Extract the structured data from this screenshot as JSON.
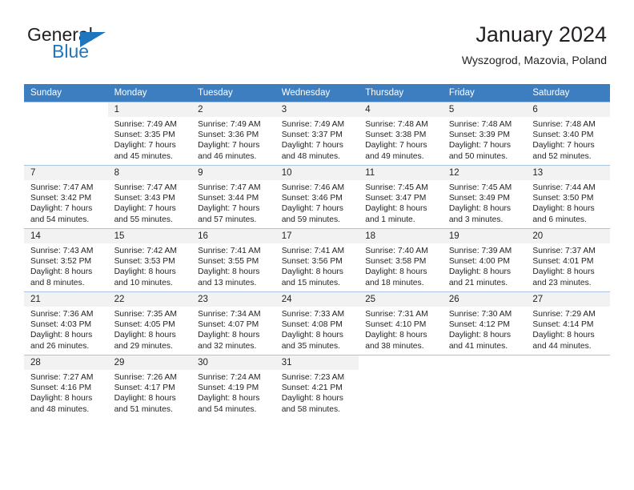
{
  "brand": {
    "name_top": "General",
    "name_bottom": "Blue",
    "color_blue": "#1f76bc",
    "color_dark": "#231f20"
  },
  "header": {
    "title": "January 2024",
    "subtitle": "Wyszogrod, Mazovia, Poland"
  },
  "calendar": {
    "header_background": "#3c7ec0",
    "daynum_background": "#f2f2f2",
    "weekday_headers": [
      "Sunday",
      "Monday",
      "Tuesday",
      "Wednesday",
      "Thursday",
      "Friday",
      "Saturday"
    ],
    "weeks": [
      [
        {
          "day": "",
          "sunrise": "",
          "sunset": "",
          "daylight": ""
        },
        {
          "day": "1",
          "sunrise": "Sunrise: 7:49 AM",
          "sunset": "Sunset: 3:35 PM",
          "daylight": "Daylight: 7 hours and 45 minutes."
        },
        {
          "day": "2",
          "sunrise": "Sunrise: 7:49 AM",
          "sunset": "Sunset: 3:36 PM",
          "daylight": "Daylight: 7 hours and 46 minutes."
        },
        {
          "day": "3",
          "sunrise": "Sunrise: 7:49 AM",
          "sunset": "Sunset: 3:37 PM",
          "daylight": "Daylight: 7 hours and 48 minutes."
        },
        {
          "day": "4",
          "sunrise": "Sunrise: 7:48 AM",
          "sunset": "Sunset: 3:38 PM",
          "daylight": "Daylight: 7 hours and 49 minutes."
        },
        {
          "day": "5",
          "sunrise": "Sunrise: 7:48 AM",
          "sunset": "Sunset: 3:39 PM",
          "daylight": "Daylight: 7 hours and 50 minutes."
        },
        {
          "day": "6",
          "sunrise": "Sunrise: 7:48 AM",
          "sunset": "Sunset: 3:40 PM",
          "daylight": "Daylight: 7 hours and 52 minutes."
        }
      ],
      [
        {
          "day": "7",
          "sunrise": "Sunrise: 7:47 AM",
          "sunset": "Sunset: 3:42 PM",
          "daylight": "Daylight: 7 hours and 54 minutes."
        },
        {
          "day": "8",
          "sunrise": "Sunrise: 7:47 AM",
          "sunset": "Sunset: 3:43 PM",
          "daylight": "Daylight: 7 hours and 55 minutes."
        },
        {
          "day": "9",
          "sunrise": "Sunrise: 7:47 AM",
          "sunset": "Sunset: 3:44 PM",
          "daylight": "Daylight: 7 hours and 57 minutes."
        },
        {
          "day": "10",
          "sunrise": "Sunrise: 7:46 AM",
          "sunset": "Sunset: 3:46 PM",
          "daylight": "Daylight: 7 hours and 59 minutes."
        },
        {
          "day": "11",
          "sunrise": "Sunrise: 7:45 AM",
          "sunset": "Sunset: 3:47 PM",
          "daylight": "Daylight: 8 hours and 1 minute."
        },
        {
          "day": "12",
          "sunrise": "Sunrise: 7:45 AM",
          "sunset": "Sunset: 3:49 PM",
          "daylight": "Daylight: 8 hours and 3 minutes."
        },
        {
          "day": "13",
          "sunrise": "Sunrise: 7:44 AM",
          "sunset": "Sunset: 3:50 PM",
          "daylight": "Daylight: 8 hours and 6 minutes."
        }
      ],
      [
        {
          "day": "14",
          "sunrise": "Sunrise: 7:43 AM",
          "sunset": "Sunset: 3:52 PM",
          "daylight": "Daylight: 8 hours and 8 minutes."
        },
        {
          "day": "15",
          "sunrise": "Sunrise: 7:42 AM",
          "sunset": "Sunset: 3:53 PM",
          "daylight": "Daylight: 8 hours and 10 minutes."
        },
        {
          "day": "16",
          "sunrise": "Sunrise: 7:41 AM",
          "sunset": "Sunset: 3:55 PM",
          "daylight": "Daylight: 8 hours and 13 minutes."
        },
        {
          "day": "17",
          "sunrise": "Sunrise: 7:41 AM",
          "sunset": "Sunset: 3:56 PM",
          "daylight": "Daylight: 8 hours and 15 minutes."
        },
        {
          "day": "18",
          "sunrise": "Sunrise: 7:40 AM",
          "sunset": "Sunset: 3:58 PM",
          "daylight": "Daylight: 8 hours and 18 minutes."
        },
        {
          "day": "19",
          "sunrise": "Sunrise: 7:39 AM",
          "sunset": "Sunset: 4:00 PM",
          "daylight": "Daylight: 8 hours and 21 minutes."
        },
        {
          "day": "20",
          "sunrise": "Sunrise: 7:37 AM",
          "sunset": "Sunset: 4:01 PM",
          "daylight": "Daylight: 8 hours and 23 minutes."
        }
      ],
      [
        {
          "day": "21",
          "sunrise": "Sunrise: 7:36 AM",
          "sunset": "Sunset: 4:03 PM",
          "daylight": "Daylight: 8 hours and 26 minutes."
        },
        {
          "day": "22",
          "sunrise": "Sunrise: 7:35 AM",
          "sunset": "Sunset: 4:05 PM",
          "daylight": "Daylight: 8 hours and 29 minutes."
        },
        {
          "day": "23",
          "sunrise": "Sunrise: 7:34 AM",
          "sunset": "Sunset: 4:07 PM",
          "daylight": "Daylight: 8 hours and 32 minutes."
        },
        {
          "day": "24",
          "sunrise": "Sunrise: 7:33 AM",
          "sunset": "Sunset: 4:08 PM",
          "daylight": "Daylight: 8 hours and 35 minutes."
        },
        {
          "day": "25",
          "sunrise": "Sunrise: 7:31 AM",
          "sunset": "Sunset: 4:10 PM",
          "daylight": "Daylight: 8 hours and 38 minutes."
        },
        {
          "day": "26",
          "sunrise": "Sunrise: 7:30 AM",
          "sunset": "Sunset: 4:12 PM",
          "daylight": "Daylight: 8 hours and 41 minutes."
        },
        {
          "day": "27",
          "sunrise": "Sunrise: 7:29 AM",
          "sunset": "Sunset: 4:14 PM",
          "daylight": "Daylight: 8 hours and 44 minutes."
        }
      ],
      [
        {
          "day": "28",
          "sunrise": "Sunrise: 7:27 AM",
          "sunset": "Sunset: 4:16 PM",
          "daylight": "Daylight: 8 hours and 48 minutes."
        },
        {
          "day": "29",
          "sunrise": "Sunrise: 7:26 AM",
          "sunset": "Sunset: 4:17 PM",
          "daylight": "Daylight: 8 hours and 51 minutes."
        },
        {
          "day": "30",
          "sunrise": "Sunrise: 7:24 AM",
          "sunset": "Sunset: 4:19 PM",
          "daylight": "Daylight: 8 hours and 54 minutes."
        },
        {
          "day": "31",
          "sunrise": "Sunrise: 7:23 AM",
          "sunset": "Sunset: 4:21 PM",
          "daylight": "Daylight: 8 hours and 58 minutes."
        },
        {
          "day": "",
          "sunrise": "",
          "sunset": "",
          "daylight": ""
        },
        {
          "day": "",
          "sunrise": "",
          "sunset": "",
          "daylight": ""
        },
        {
          "day": "",
          "sunrise": "",
          "sunset": "",
          "daylight": ""
        }
      ]
    ]
  }
}
